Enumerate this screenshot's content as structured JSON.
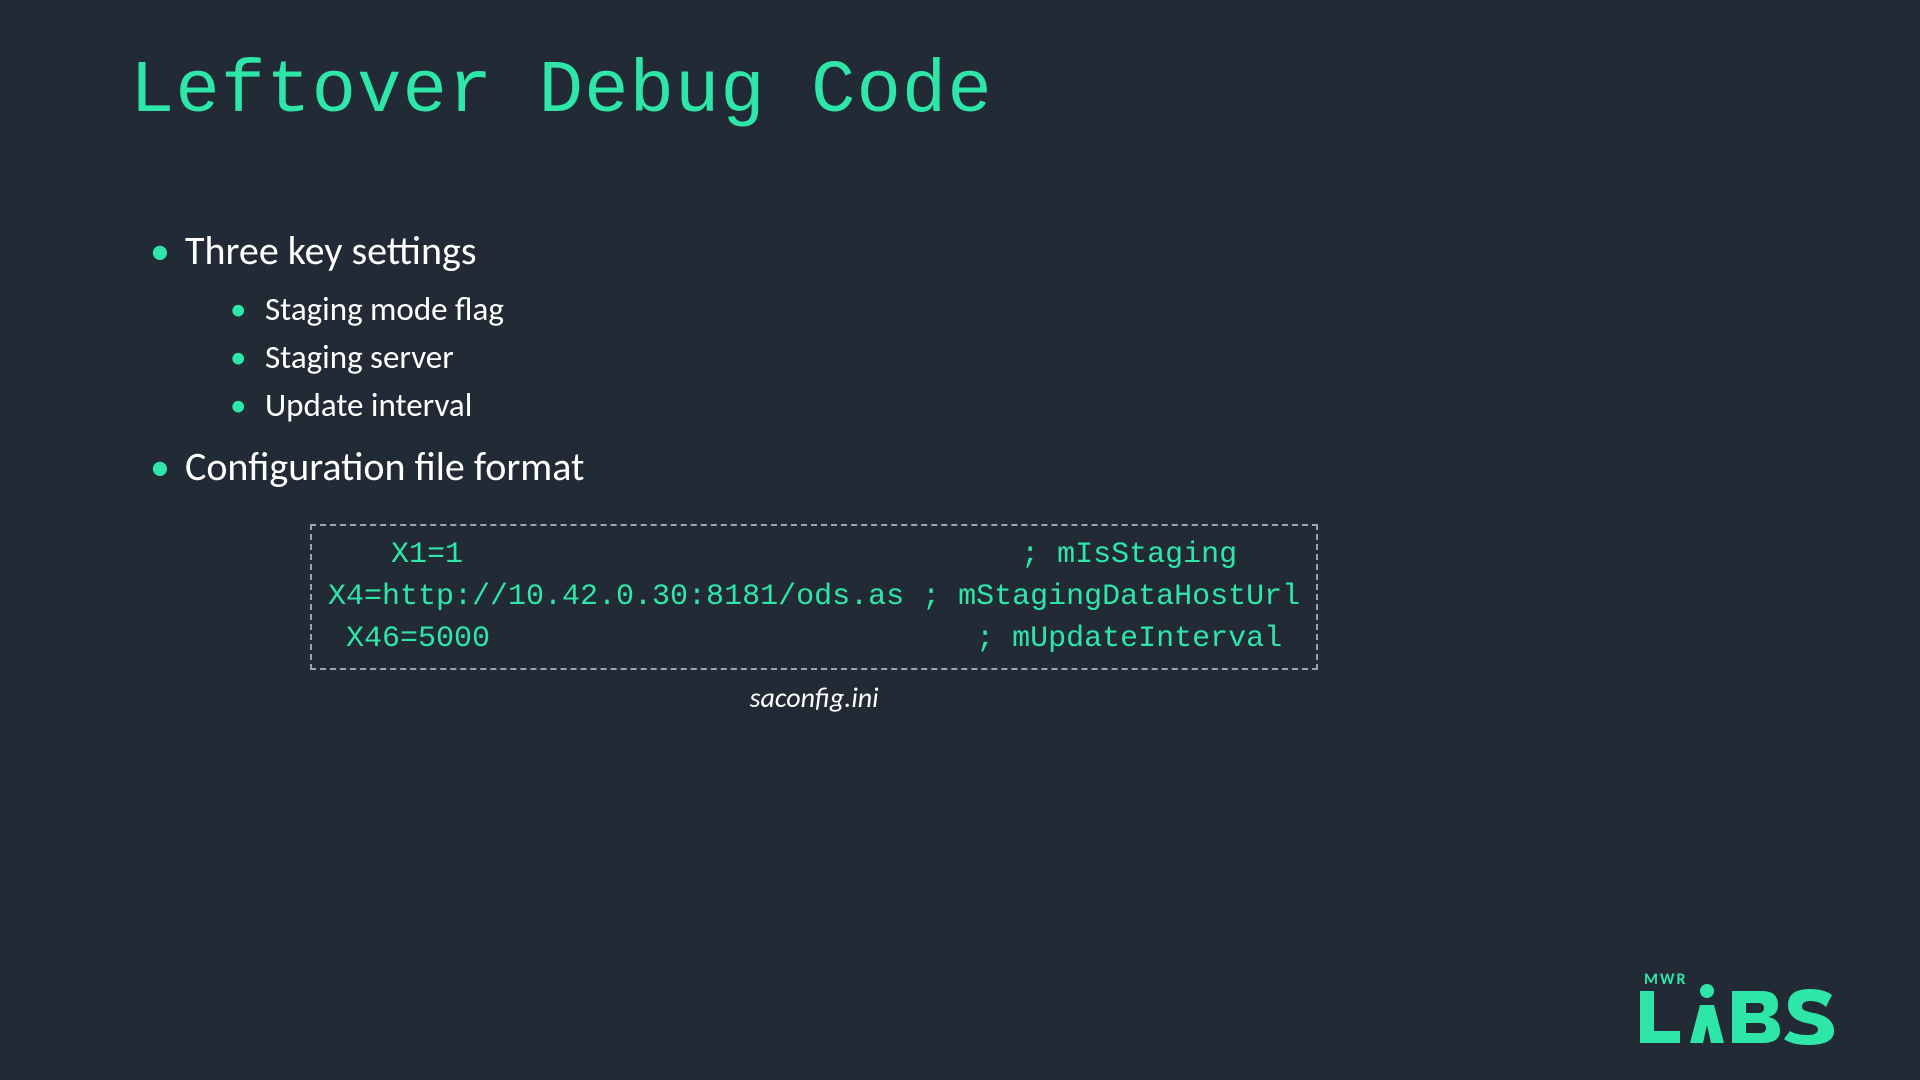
{
  "title": "Leftover Debug Code",
  "bullets": {
    "b1": "Three key settings",
    "b1_sub": [
      "Staging mode flag",
      "Staging server",
      "Update interval"
    ],
    "b2": "Configuration file format"
  },
  "code": {
    "line1": "X1=1                               ; mIsStaging",
    "line2": "X4=http://10.42.0.30:8181/ods.as ; mStagingDataHostUrl",
    "line3": "X46=5000                           ; mUpdateInterval",
    "caption": "saconfig.ini"
  },
  "logo": {
    "top": "MWR",
    "bottom": "LABS"
  }
}
